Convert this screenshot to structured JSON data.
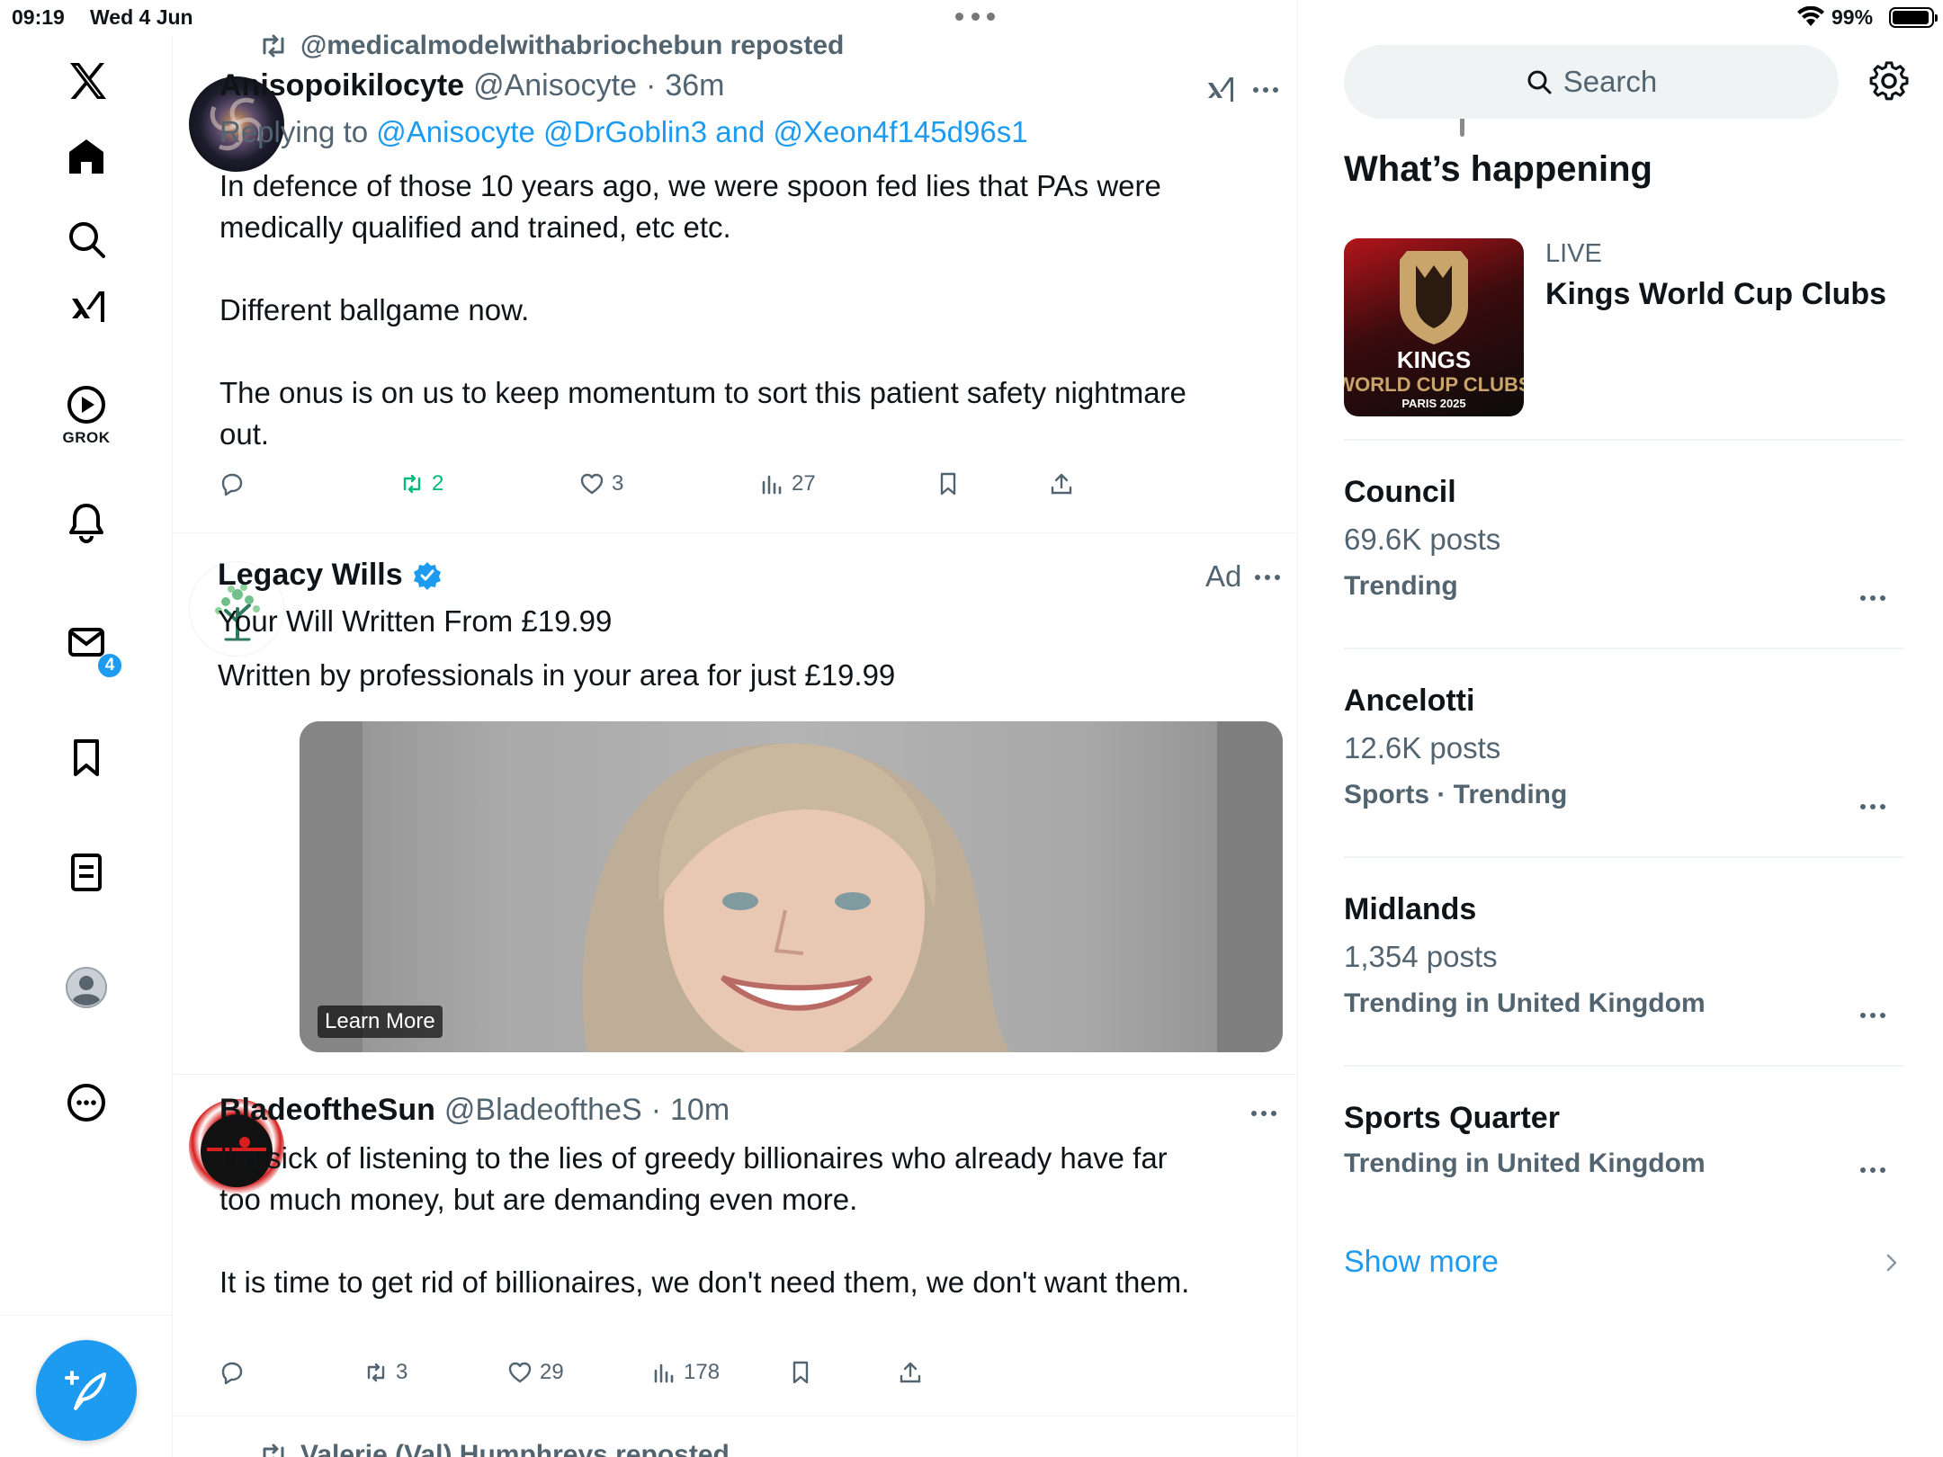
{
  "status_bar": {
    "time": "09:19",
    "date": "Wed 4 Jun",
    "battery": "99%"
  },
  "nav": {
    "grok_label": "GROK",
    "notification_count": "4"
  },
  "feed": {
    "tweet1": {
      "reposted_by": "@medicalmodelwithabriochebun reposted",
      "name": "Anisopoikilocyte",
      "handle": "@Anisocyte",
      "time": "36m",
      "replying_prefix": "Replying to",
      "replying_mentions": "@Anisocyte @DrGoblin3 and @Xeon4f145d96s1",
      "body": [
        "In defence of those 10 years ago, we were spoon fed lies that PAs were medically qualified and trained, etc etc.",
        "Different ballgame now.",
        "The onus is on us to keep momentum to sort this patient safety nightmare out."
      ],
      "reposts": "2",
      "likes": "3",
      "views": "27"
    },
    "ad": {
      "name": "Legacy Wills",
      "label": "Ad",
      "headline": "Your Will Written From £19.99",
      "subline": "Written by professionals in your area for just £19.99",
      "cta": "Learn More"
    },
    "tweet2": {
      "name": "BladeoftheSun",
      "handle": "@BladeoftheS",
      "time": "10m",
      "body": [
        "I'm sick of listening to the lies of greedy billionaires who already have far too much money, but are demanding even more.",
        "It is time to get rid of billionaires, we don't need them, we don't want them."
      ],
      "reposts": "3",
      "likes": "29",
      "views": "178"
    },
    "next_repost": "Valerie (Val) Humphreys reposted"
  },
  "right": {
    "search_placeholder": "Search",
    "section_title": "What’s happening",
    "live_event": {
      "status": "LIVE",
      "title": "Kings World Cup Clubs",
      "logo_line1": "KINGS",
      "logo_line2": "WORLD CUP CLUBS",
      "logo_line3": "PARIS 2025"
    },
    "trends": [
      {
        "name": "Council",
        "posts": "69.6K posts",
        "meta": "Trending"
      },
      {
        "name": "Ancelotti",
        "posts": "12.6K posts",
        "meta": "Sports · Trending"
      },
      {
        "name": "Midlands",
        "posts": "1,354 posts",
        "meta": "Trending in United Kingdom"
      },
      {
        "name": "Sports Quarter",
        "posts": "",
        "meta": "Trending in United Kingdom"
      }
    ],
    "show_more": "Show more"
  },
  "colors": {
    "accent": "#1d9bf0",
    "repost_green": "#00ba7c",
    "secondary_text": "#536471"
  }
}
